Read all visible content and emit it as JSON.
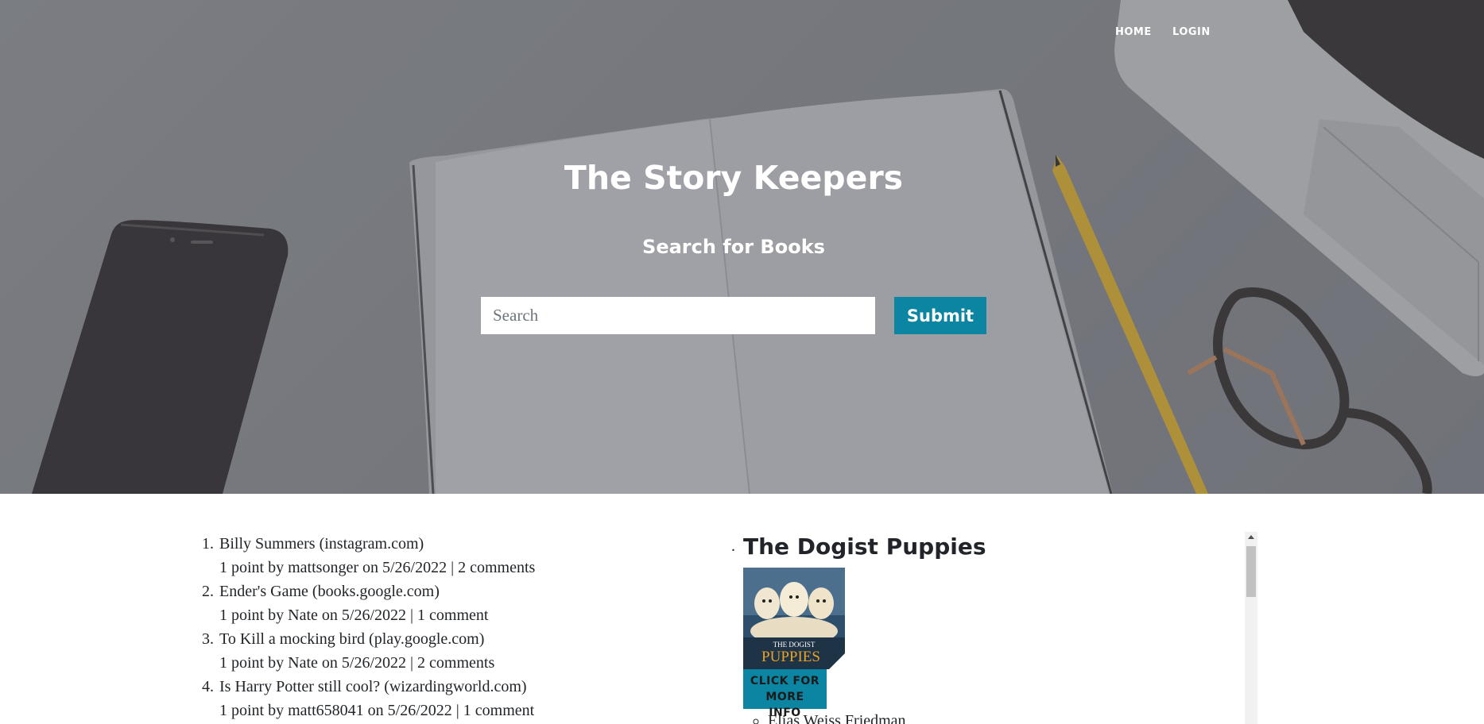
{
  "nav": {
    "home": "HOME",
    "login": "LOGIN"
  },
  "hero": {
    "title": "The Story Keepers",
    "subtitle": "Search for Books"
  },
  "search": {
    "placeholder": "Search",
    "value": "",
    "submit_label": "Submit"
  },
  "posts": [
    {
      "title": "Billy Summers",
      "domain": "(instagram.com)",
      "meta_prefix": "1 point by",
      "user": "mattsonger",
      "date_text": "on 5/26/2022 |",
      "comments": "2 comments"
    },
    {
      "title": "Ender's Game",
      "domain": "(books.google.com)",
      "meta_prefix": "1 point by",
      "user": "Nate",
      "date_text": "on 5/26/2022 |",
      "comments": "1 comment"
    },
    {
      "title": "To Kill a mocking bird",
      "domain": "(play.google.com)",
      "meta_prefix": "1 point by",
      "user": "Nate",
      "date_text": "on 5/26/2022 |",
      "comments": "2 comments"
    },
    {
      "title": "Is Harry Potter still cool?",
      "domain": "(wizardingworld.com)",
      "meta_prefix": "1 point by",
      "user": "matt658041",
      "date_text": "on 5/26/2022 |",
      "comments": "1 comment"
    }
  ],
  "featured": {
    "bullet": ".",
    "title": "The Dogist Puppies",
    "cover_title": "THE DOGIST",
    "cover_word": "PUPPIES",
    "info_button_line1": "CLICK FOR",
    "info_button_line2": "MORE INFO",
    "authors": [
      "Elias Weiss Friedman"
    ]
  },
  "colors": {
    "accent": "#0b85a1",
    "hero_overlay": "#7e8186",
    "text": "#212529"
  }
}
